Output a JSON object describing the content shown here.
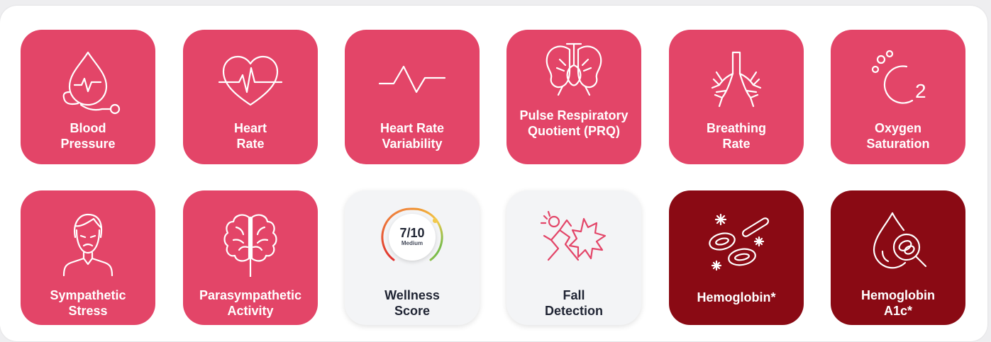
{
  "tiles": {
    "blood_pressure": {
      "line1": "Blood",
      "line2": "Pressure"
    },
    "heart_rate": {
      "line1": "Heart",
      "line2": "Rate"
    },
    "hrv": {
      "line1": "Heart Rate",
      "line2": "Variability"
    },
    "prq": {
      "line1": "Pulse Respiratory",
      "line2": "Quotient (PRQ)"
    },
    "breathing_rate": {
      "line1": "Breathing",
      "line2": "Rate"
    },
    "oxygen": {
      "line1": "Oxygen",
      "line2": "Saturation"
    },
    "sympathetic": {
      "line1": "Sympathetic",
      "line2": "Stress"
    },
    "parasympathetic": {
      "line1": "Parasympathetic",
      "line2": "Activity"
    },
    "wellness": {
      "line1": "Wellness",
      "line2": "Score",
      "score": "7/10",
      "level": "Medium",
      "score_value": 7,
      "score_max": 10
    },
    "fall": {
      "line1": "Fall",
      "line2": "Detection"
    },
    "hemoglobin": {
      "line1": "Hemoglobin*"
    },
    "hba1c": {
      "line1": "Hemoglobin",
      "line2": "A1c*"
    },
    "oxygen_icon_text": "2"
  },
  "colors": {
    "pink": "#e34568",
    "dark_red": "#8a0a14",
    "light": "#f3f4f6"
  }
}
